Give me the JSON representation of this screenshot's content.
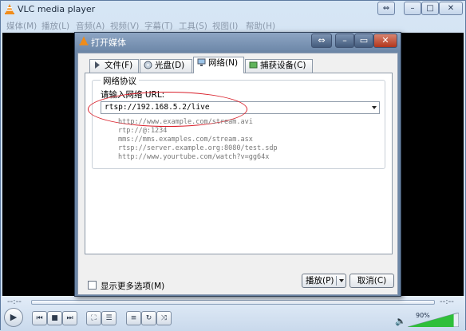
{
  "app": {
    "title": "VLC media player",
    "menu": [
      "媒体(M)",
      "播放(L)",
      "音频(A)",
      "视频(V)",
      "字幕(T)",
      "工具(S)",
      "视图(I)",
      "帮助(H)"
    ]
  },
  "controls": {
    "time_elapsed": "--:--",
    "time_total": "--:--",
    "volume_percent": "90%",
    "volume_level": 0.9
  },
  "dialog": {
    "title": "打开媒体",
    "tabs": [
      {
        "label": "文件(F)",
        "icon": "file-icon"
      },
      {
        "label": "光盘(D)",
        "icon": "disc-icon"
      },
      {
        "label": "网络(N)",
        "icon": "network-icon",
        "active": true
      },
      {
        "label": "捕获设备(C)",
        "icon": "capture-device-icon"
      }
    ],
    "group_title": "网络协议",
    "url_label": "请输入网络 URL:",
    "url_value": "rtsp://192.168.5.2/live",
    "examples": [
      "http://www.example.com/stream.avi",
      "rtp://@:1234",
      "mms://mms.examples.com/stream.asx",
      "rtsp://server.example.org:8080/test.sdp",
      "http://www.yourtube.com/watch?v=gg64x"
    ],
    "more_options": "显示更多选项(M)",
    "play_button": "播放(P)",
    "cancel_button": "取消(C)"
  },
  "colors": {
    "highlight_oval": "#d9202b",
    "volume_fill": "#2fbf3a",
    "video_bg": "#000000"
  }
}
